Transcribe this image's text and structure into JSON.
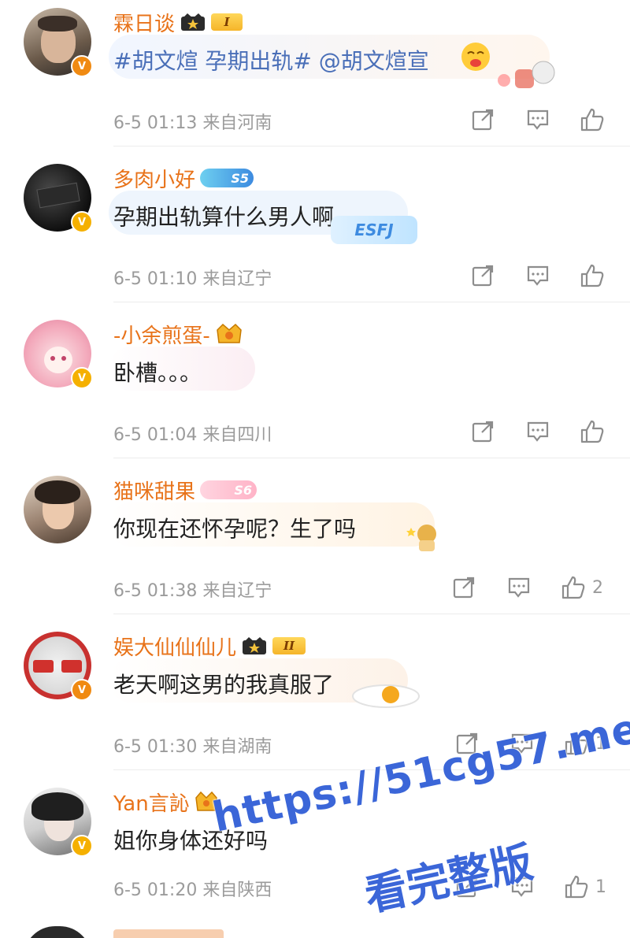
{
  "comments": [
    {
      "name": "霖日谈",
      "badge": "I",
      "text": "#胡文煊 孕期出轨# @胡文煊宣",
      "time": "6-5 01:13",
      "location": "来自河南",
      "likes": ""
    },
    {
      "name": "多肉小好",
      "badge": "S5",
      "text": "孕期出轨算什么男人啊",
      "time": "6-5 01:10",
      "location": "来自辽宁",
      "likes": ""
    },
    {
      "name": "-小余煎蛋-",
      "badge": "",
      "text": "卧槽。。。",
      "time": "6-5 01:04",
      "location": "来自四川",
      "likes": ""
    },
    {
      "name": "猫咪甜果",
      "badge": "S6",
      "text": "你现在还怀孕呢？生了吗",
      "time": "6-5 01:38",
      "location": "来自辽宁",
      "likes": "2"
    },
    {
      "name": "娱大仙仙仙儿",
      "badge": "II",
      "text": "老天啊这男的我真服了",
      "time": "6-5 01:30",
      "location": "来自湖南",
      "likes": "1"
    },
    {
      "name": "Yan言訫",
      "badge": "",
      "text": "姐你身体还好吗",
      "time": "6-5 01:20",
      "location": "来自陕西",
      "likes": "1"
    }
  ],
  "bubble_stickers": [
    "ESFJ"
  ],
  "watermark": {
    "line1": "https://51cg57.me",
    "line2": "看完整版"
  },
  "colors": {
    "name": "#e8731a",
    "meta": "#9b9b9b",
    "text": "#222222",
    "watermark": "#3b66d8",
    "verified_orange": "#f08a12",
    "verified_gold": "#f5b000"
  }
}
